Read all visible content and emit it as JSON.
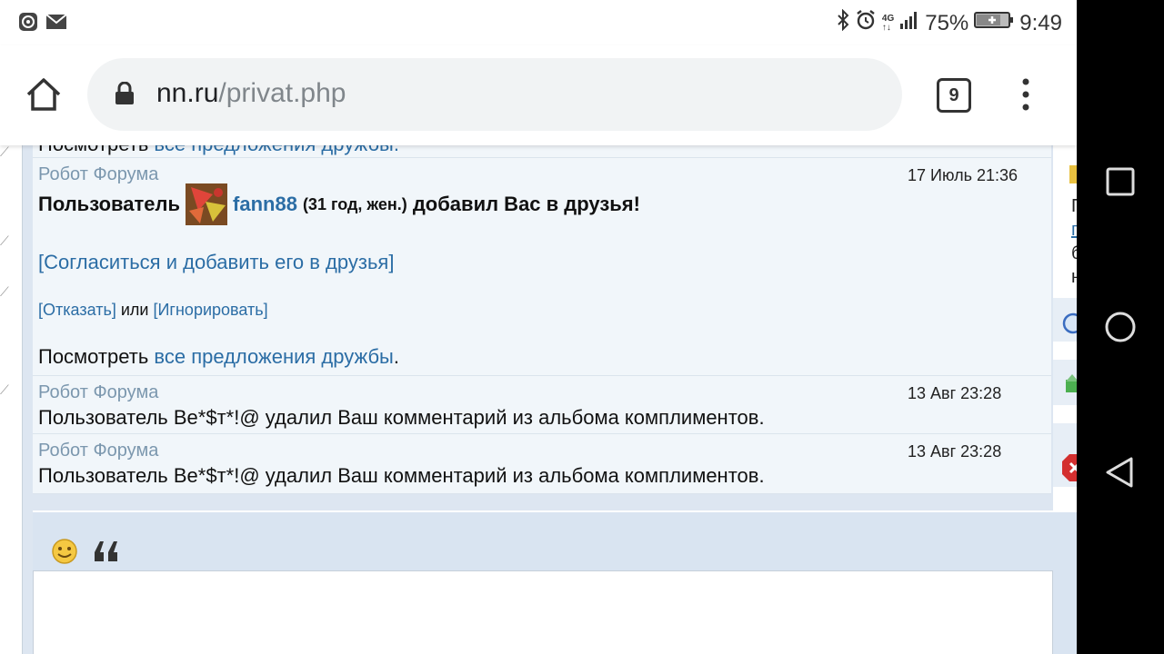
{
  "status_bar": {
    "network_top": "4G",
    "network_bottom": "↑↓",
    "battery_percent": "75%",
    "time": "9:49"
  },
  "browser": {
    "url_domain": "nn.ru",
    "url_path": "/privat.php",
    "tab_count": "9"
  },
  "messages": {
    "cut_top_prefix": "Посмотреть",
    "cut_top_link": "все предложения дружбы.",
    "friend_request": {
      "sender": "Робот Форума",
      "date": "17 Июль 21:36",
      "text_before": "Пользователь",
      "username": "fann88",
      "user_meta": "(31 год, жен.)",
      "text_after": "добавил Вас в друзья!",
      "accept_link": "[Согласиться и добавить его в друзья]",
      "decline_link": "[Отказать]",
      "or_text": "или",
      "ignore_link": "[Игнорировать]",
      "view_prefix": "Посмотреть",
      "view_link": "все предложения дружбы",
      "view_suffix": "."
    },
    "items": [
      {
        "sender": "Робот Форума",
        "date": "13 Авг 23:28",
        "text": "Пользователь Be*$т*!@ удалил Ваш комментарий из альбома комплиментов."
      },
      {
        "sender": "Робот Форума",
        "date": "13 Авг 23:28",
        "text": "Пользователь Be*$т*!@ удалил Ваш комментарий из альбома комплиментов."
      }
    ]
  },
  "right_strip": {
    "c1": "П",
    "c2": "п",
    "c3": "б",
    "c4": "н"
  },
  "colors": {
    "link": "#2b6da5",
    "sender": "#7b97ae",
    "panel_bg": "#f1f6fa",
    "page_bg": "#dde6f1"
  }
}
